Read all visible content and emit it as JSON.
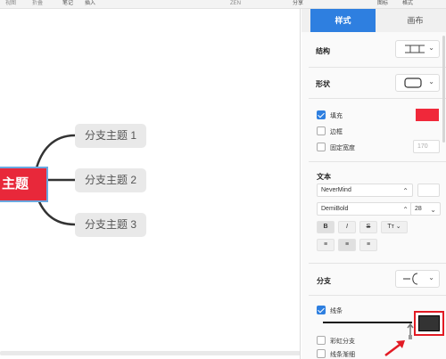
{
  "toolbar": {
    "items": [
      "视图",
      "折叠",
      "笔记",
      "插入"
    ],
    "zen": "ZEN",
    "share": "分享",
    "right_items": [
      "图标",
      "格式"
    ]
  },
  "canvas": {
    "central_topic": "主题",
    "subtopics": [
      "分支主题 1",
      "分支主题 2",
      "分支主题 3"
    ]
  },
  "panel": {
    "tabs": {
      "style": "样式",
      "canvas": "画布"
    },
    "structure_label": "结构",
    "shape_label": "形状",
    "fill_label": "填充",
    "fill_checked": true,
    "fill_color": "#f0283a",
    "border_label": "边框",
    "border_checked": false,
    "fixed_width_label": "固定宽度",
    "fixed_width_checked": false,
    "fixed_width_value": "170",
    "text_label": "文本",
    "font_family": "NeverMind",
    "font_weight": "DemiBold",
    "font_size": "28",
    "format_buttons": {
      "bold": "B",
      "italic": "I",
      "strike": "S",
      "case": "Tт"
    },
    "branch_label": "分支",
    "line_label": "线条",
    "line_checked": true,
    "line_color": "#333333",
    "rainbow_label": "彩虹分支",
    "rainbow_checked": false,
    "taper_label": "线条渐细",
    "taper_checked": false
  },
  "colors": {
    "accent": "#2e7fe0",
    "central": "#e8283a",
    "highlight": "#e21b24"
  }
}
